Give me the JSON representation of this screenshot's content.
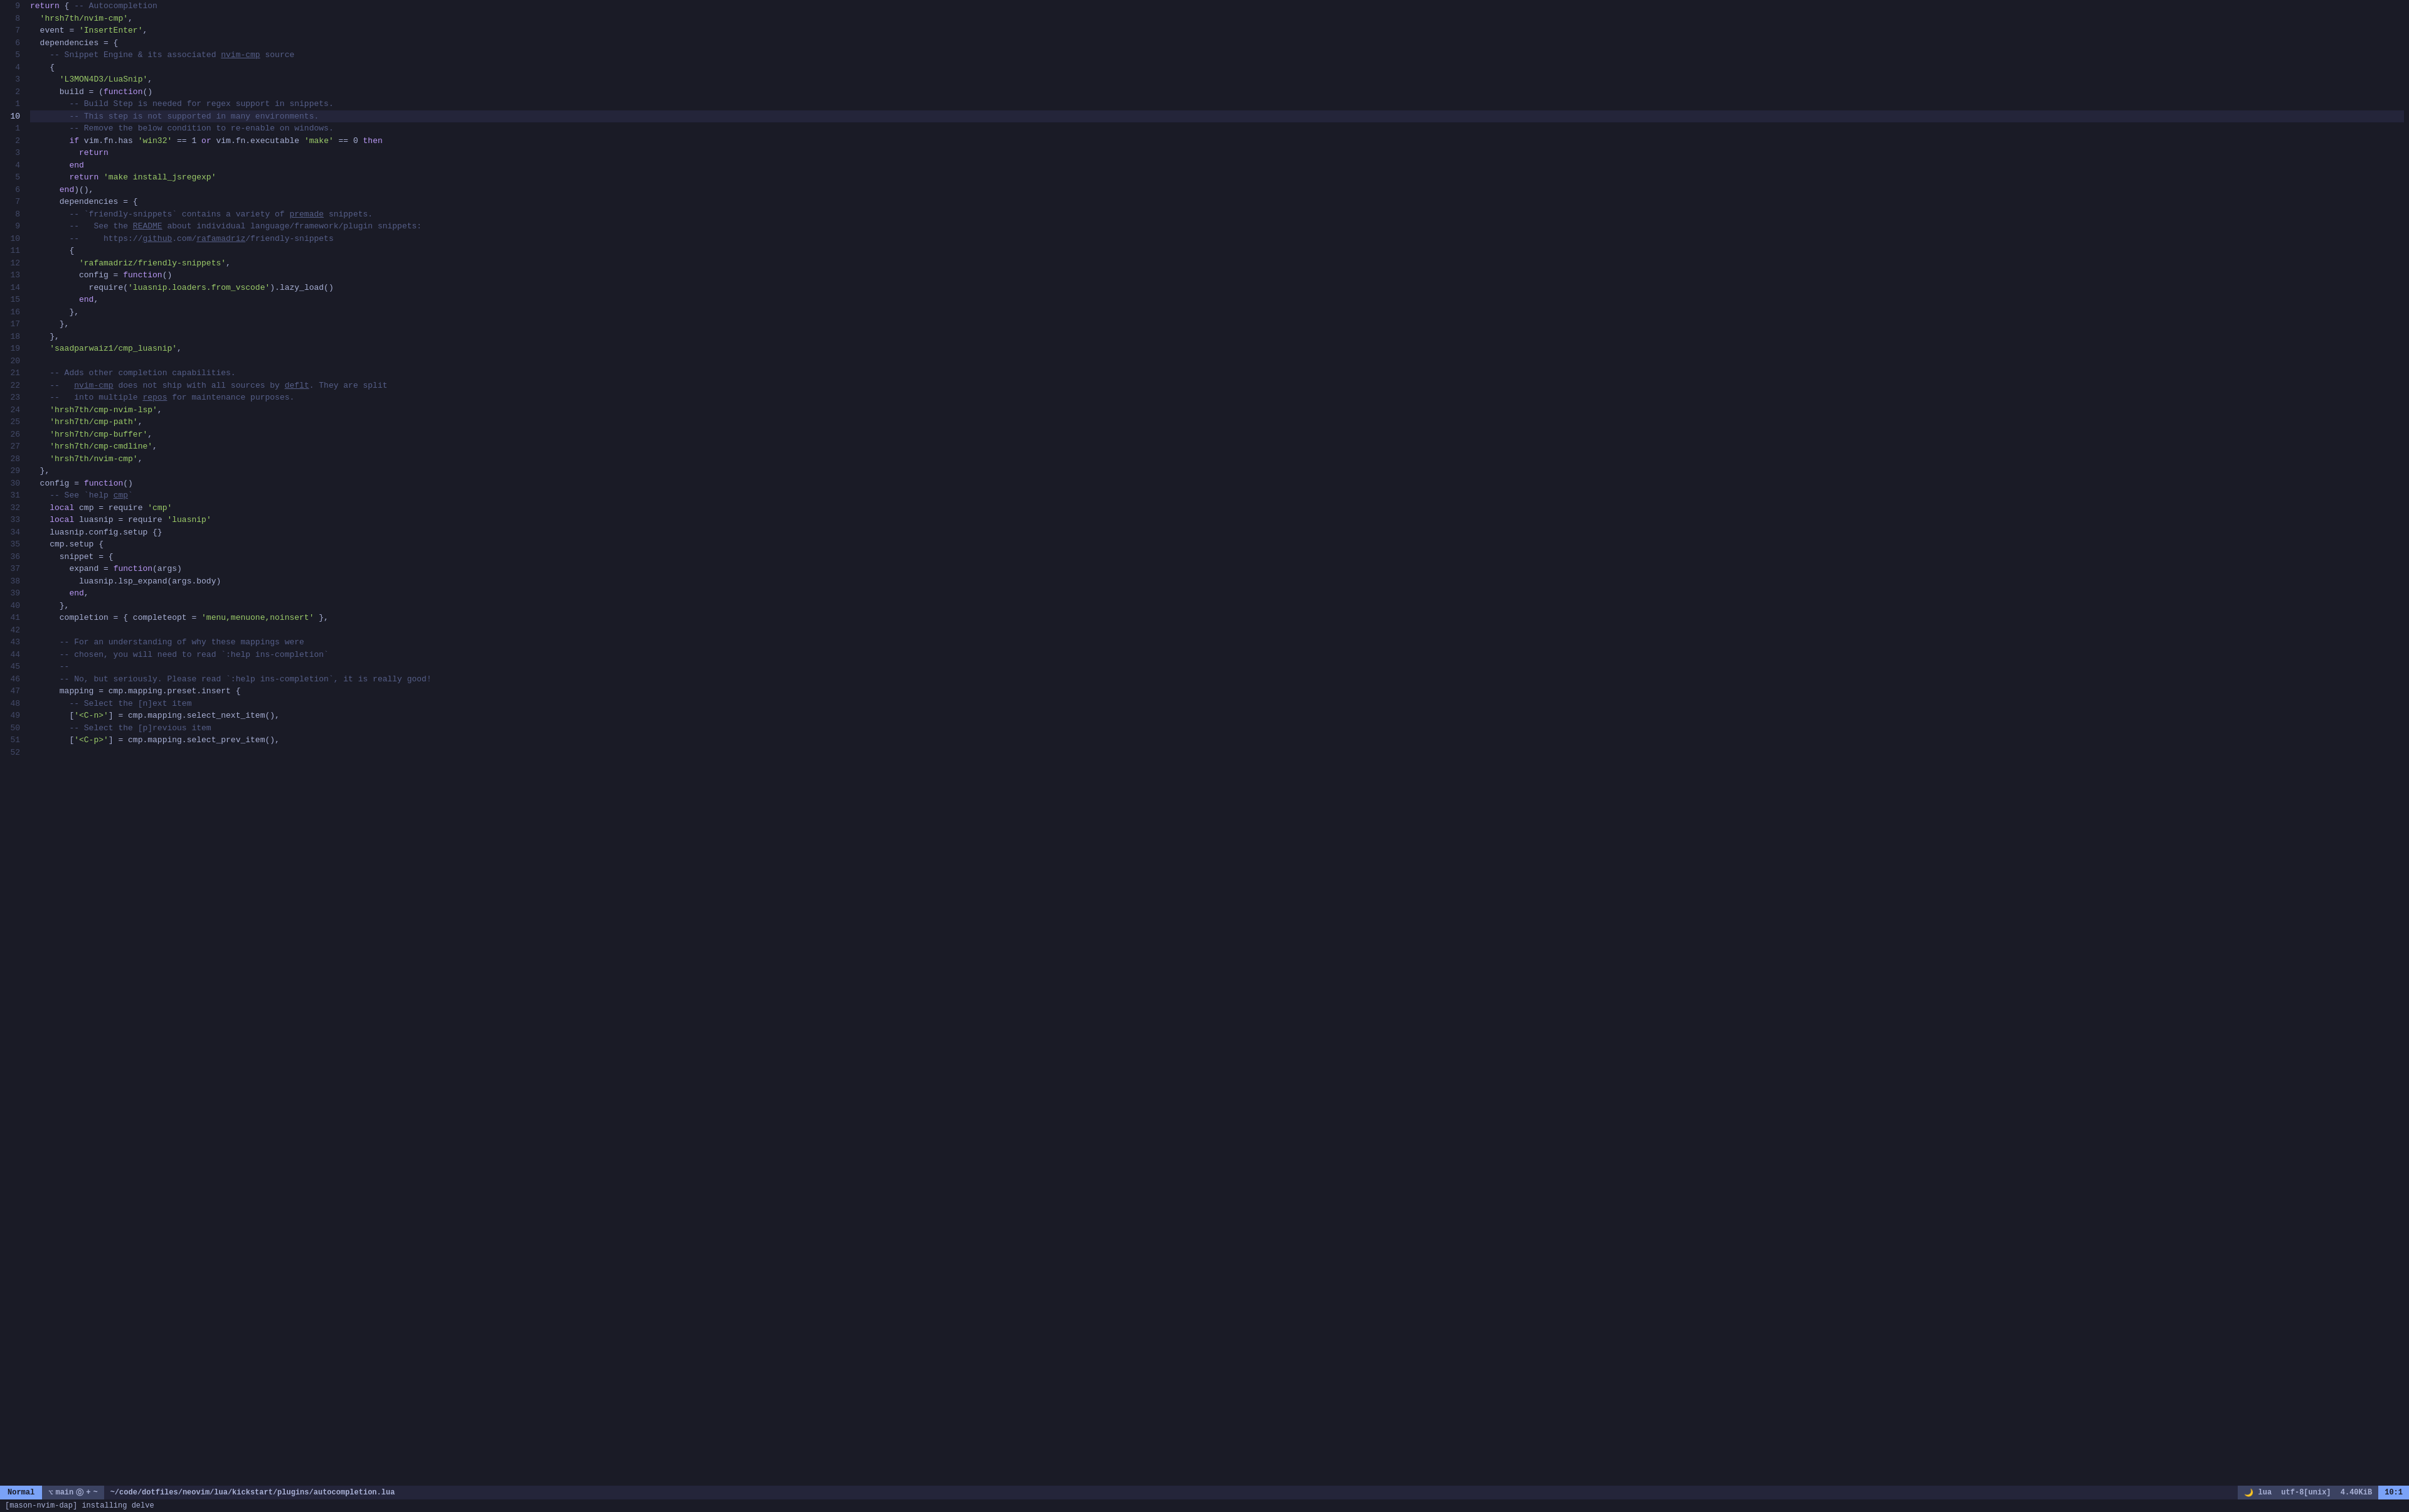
{
  "editor": {
    "lines": [
      {
        "num": 9,
        "content": "return { -- Autocompletion",
        "tokens": [
          {
            "t": "kw",
            "v": "return"
          },
          {
            "t": "plain",
            "v": " { "
          },
          {
            "t": "cmt",
            "v": "-- Autocompletion"
          }
        ]
      },
      {
        "num": 8,
        "content": "  'hrsh7th/nvim-cmp',",
        "tokens": [
          {
            "t": "plain",
            "v": "  "
          },
          {
            "t": "str",
            "v": "'hrsh7th/nvim-cmp'"
          },
          {
            "t": "plain",
            "v": ","
          }
        ]
      },
      {
        "num": 7,
        "content": "  event = 'InsertEnter',",
        "tokens": [
          {
            "t": "plain",
            "v": "  event = "
          },
          {
            "t": "str",
            "v": "'InsertEnter'"
          },
          {
            "t": "plain",
            "v": ","
          }
        ]
      },
      {
        "num": 6,
        "content": "  dependencies = {",
        "tokens": [
          {
            "t": "plain",
            "v": "  dependencies = {"
          }
        ]
      },
      {
        "num": 5,
        "content": "    -- Snippet Engine & its associated nvim-cmp source",
        "tokens": [
          {
            "t": "cmt",
            "v": "    -- Snippet Engine & its associated "
          },
          {
            "t": "cmt-link",
            "v": "nvim-cmp"
          },
          {
            "t": "cmt",
            "v": " source"
          }
        ]
      },
      {
        "num": 4,
        "content": "    {",
        "tokens": [
          {
            "t": "plain",
            "v": "    {"
          }
        ]
      },
      {
        "num": 3,
        "content": "      'L3MON4D3/LuaSnip',",
        "tokens": [
          {
            "t": "plain",
            "v": "      "
          },
          {
            "t": "str",
            "v": "'L3MON4D3/LuaSnip'"
          },
          {
            "t": "plain",
            "v": ","
          }
        ]
      },
      {
        "num": 2,
        "content": "      build = (function()",
        "tokens": [
          {
            "t": "plain",
            "v": "      build = ("
          },
          {
            "t": "kw",
            "v": "function"
          },
          {
            "t": "plain",
            "v": "()"
          }
        ]
      },
      {
        "num": 1,
        "content": "        -- Build Step is needed for regex support in snippets.",
        "tokens": [
          {
            "t": "cmt",
            "v": "        -- Build Step is needed for regex support in snippets."
          }
        ]
      },
      {
        "num": 10,
        "content": "        -- This step is not supported in many environments.",
        "tokens": [
          {
            "t": "cmt",
            "v": "        -- This step is not supported in many environments."
          }
        ],
        "current": true
      },
      {
        "num": 1,
        "content": "        -- Remove the below condition to re-enable on windows.",
        "tokens": [
          {
            "t": "cmt",
            "v": "        -- Remove the below condition to re-enable on windows."
          }
        ]
      },
      {
        "num": 2,
        "content": "        if vim.fn.has 'win32' == 1 or vim.fn.executable 'make' == 0 then",
        "tokens": [
          {
            "t": "plain",
            "v": "        "
          },
          {
            "t": "kw",
            "v": "if"
          },
          {
            "t": "plain",
            "v": " vim.fn.has "
          },
          {
            "t": "str",
            "v": "'win32'"
          },
          {
            "t": "plain",
            "v": " == 1 "
          },
          {
            "t": "kw",
            "v": "or"
          },
          {
            "t": "plain",
            "v": " vim.fn.executable "
          },
          {
            "t": "str",
            "v": "'make'"
          },
          {
            "t": "plain",
            "v": " == 0 "
          },
          {
            "t": "kw",
            "v": "then"
          }
        ]
      },
      {
        "num": 3,
        "content": "          return",
        "tokens": [
          {
            "t": "plain",
            "v": "          "
          },
          {
            "t": "kw",
            "v": "return"
          }
        ]
      },
      {
        "num": 4,
        "content": "        end",
        "tokens": [
          {
            "t": "plain",
            "v": "        "
          },
          {
            "t": "kw",
            "v": "end"
          }
        ]
      },
      {
        "num": 5,
        "content": "        return 'make install_jsregexp'",
        "tokens": [
          {
            "t": "plain",
            "v": "        "
          },
          {
            "t": "kw",
            "v": "return"
          },
          {
            "t": "plain",
            "v": " "
          },
          {
            "t": "str",
            "v": "'make install_jsregexp'"
          }
        ]
      },
      {
        "num": 6,
        "content": "      end)(),",
        "tokens": [
          {
            "t": "plain",
            "v": "      "
          },
          {
            "t": "kw",
            "v": "end"
          },
          {
            "t": "plain",
            "v": ")(),"
          }
        ]
      },
      {
        "num": 7,
        "content": "      dependencies = {",
        "tokens": [
          {
            "t": "plain",
            "v": "      dependencies = {"
          }
        ]
      },
      {
        "num": 8,
        "content": "        -- `friendly-snippets` contains a variety of premade snippets.",
        "tokens": [
          {
            "t": "cmt",
            "v": "        -- `friendly-snippets` contains a variety of "
          },
          {
            "t": "cmt-link",
            "v": "premade"
          },
          {
            "t": "cmt",
            "v": " snippets."
          }
        ]
      },
      {
        "num": 9,
        "content": "        --   See the README about individual language/framework/plugin snippets:",
        "tokens": [
          {
            "t": "cmt",
            "v": "        --   See the "
          },
          {
            "t": "cmt-link",
            "v": "README"
          },
          {
            "t": "cmt",
            "v": " about individual language/framework/plugin snippets:"
          }
        ]
      },
      {
        "num": 10,
        "content": "        --     https://github.com/rafamadriz/friendly-snippets",
        "tokens": [
          {
            "t": "cmt",
            "v": "        --     https://"
          },
          {
            "t": "cmt-link",
            "v": "github"
          },
          {
            "t": "cmt",
            "v": ".com/"
          },
          {
            "t": "cmt-link",
            "v": "rafamadriz"
          },
          {
            "t": "cmt",
            "v": "/friendly-snippets"
          }
        ]
      },
      {
        "num": 11,
        "content": "        {",
        "tokens": [
          {
            "t": "plain",
            "v": "        {"
          }
        ]
      },
      {
        "num": 12,
        "content": "          'rafamadriz/friendly-snippets',",
        "tokens": [
          {
            "t": "plain",
            "v": "          "
          },
          {
            "t": "str",
            "v": "'rafamadriz/friendly-snippets'"
          },
          {
            "t": "plain",
            "v": ","
          }
        ]
      },
      {
        "num": 13,
        "content": "          config = function()",
        "tokens": [
          {
            "t": "plain",
            "v": "          config = "
          },
          {
            "t": "kw",
            "v": "function"
          },
          {
            "t": "plain",
            "v": "()"
          }
        ]
      },
      {
        "num": 14,
        "content": "            require('luasnip.loaders.from_vscode').lazy_load()",
        "tokens": [
          {
            "t": "plain",
            "v": "            require("
          },
          {
            "t": "str",
            "v": "'luasnip.loaders.from_vscode'"
          },
          {
            "t": "plain",
            "v": ").lazy_load()"
          }
        ]
      },
      {
        "num": 15,
        "content": "          end,",
        "tokens": [
          {
            "t": "plain",
            "v": "          "
          },
          {
            "t": "kw",
            "v": "end"
          },
          {
            "t": "plain",
            "v": ","
          }
        ]
      },
      {
        "num": 16,
        "content": "        },",
        "tokens": [
          {
            "t": "plain",
            "v": "        },"
          }
        ]
      },
      {
        "num": 17,
        "content": "      },",
        "tokens": [
          {
            "t": "plain",
            "v": "      },"
          }
        ]
      },
      {
        "num": 18,
        "content": "    },",
        "tokens": [
          {
            "t": "plain",
            "v": "    },"
          }
        ]
      },
      {
        "num": 19,
        "content": "    'saadparwaiz1/cmp_luasnip',",
        "tokens": [
          {
            "t": "plain",
            "v": "    "
          },
          {
            "t": "str",
            "v": "'saadparwaiz1/cmp_luasnip'"
          },
          {
            "t": "plain",
            "v": ","
          }
        ]
      },
      {
        "num": 20,
        "content": "",
        "tokens": []
      },
      {
        "num": 21,
        "content": "    -- Adds other completion capabilities.",
        "tokens": [
          {
            "t": "cmt",
            "v": "    -- Adds other completion capabilities."
          }
        ]
      },
      {
        "num": 22,
        "content": "    --   nvim-cmp does not ship with all sources by deflt. They are split",
        "tokens": [
          {
            "t": "cmt",
            "v": "    --   "
          },
          {
            "t": "cmt-link",
            "v": "nvim-cmp"
          },
          {
            "t": "cmt",
            "v": " does not ship with all sources by "
          },
          {
            "t": "cmt-link",
            "v": "deflt"
          },
          {
            "t": "cmt",
            "v": ". They are split"
          }
        ]
      },
      {
        "num": 23,
        "content": "    --   into multiple repos for maintenance purposes.",
        "tokens": [
          {
            "t": "cmt",
            "v": "    --   into multiple "
          },
          {
            "t": "cmt-link",
            "v": "repos"
          },
          {
            "t": "cmt",
            "v": " for maintenance purposes."
          }
        ]
      },
      {
        "num": 24,
        "content": "    'hrsh7th/cmp-nvim-lsp',",
        "tokens": [
          {
            "t": "plain",
            "v": "    "
          },
          {
            "t": "str",
            "v": "'hrsh7th/cmp-nvim-lsp'"
          },
          {
            "t": "plain",
            "v": ","
          }
        ]
      },
      {
        "num": 25,
        "content": "    'hrsh7th/cmp-path',",
        "tokens": [
          {
            "t": "plain",
            "v": "    "
          },
          {
            "t": "str",
            "v": "'hrsh7th/cmp-path'"
          },
          {
            "t": "plain",
            "v": ","
          }
        ]
      },
      {
        "num": 26,
        "content": "    'hrsh7th/cmp-buffer',",
        "tokens": [
          {
            "t": "plain",
            "v": "    "
          },
          {
            "t": "str",
            "v": "'hrsh7th/cmp-buffer'"
          },
          {
            "t": "plain",
            "v": ","
          }
        ]
      },
      {
        "num": 27,
        "content": "    'hrsh7th/cmp-cmdline',",
        "tokens": [
          {
            "t": "plain",
            "v": "    "
          },
          {
            "t": "str",
            "v": "'hrsh7th/cmp-cmdline'"
          },
          {
            "t": "plain",
            "v": ","
          }
        ]
      },
      {
        "num": 28,
        "content": "    'hrsh7th/nvim-cmp',",
        "tokens": [
          {
            "t": "plain",
            "v": "    "
          },
          {
            "t": "str",
            "v": "'hrsh7th/nvim-cmp'"
          },
          {
            "t": "plain",
            "v": ","
          }
        ]
      },
      {
        "num": 29,
        "content": "  },",
        "tokens": [
          {
            "t": "plain",
            "v": "  },"
          }
        ]
      },
      {
        "num": 30,
        "content": "  config = function()",
        "tokens": [
          {
            "t": "plain",
            "v": "  config = "
          },
          {
            "t": "kw",
            "v": "function"
          },
          {
            "t": "plain",
            "v": "()"
          }
        ]
      },
      {
        "num": 31,
        "content": "    -- See `help cmp`",
        "tokens": [
          {
            "t": "cmt",
            "v": "    -- See "
          },
          {
            "t": "cmt",
            "v": "`help "
          },
          {
            "t": "cmt-link",
            "v": "cmp"
          },
          {
            "t": "cmt",
            "v": "`"
          }
        ]
      },
      {
        "num": 32,
        "content": "    local cmp = require 'cmp'",
        "tokens": [
          {
            "t": "plain",
            "v": "    "
          },
          {
            "t": "kw",
            "v": "local"
          },
          {
            "t": "plain",
            "v": " cmp = require "
          },
          {
            "t": "str",
            "v": "'cmp'"
          }
        ]
      },
      {
        "num": 33,
        "content": "    local luasnip = require 'luasnip'",
        "tokens": [
          {
            "t": "plain",
            "v": "    "
          },
          {
            "t": "kw",
            "v": "local"
          },
          {
            "t": "plain",
            "v": " luasnip = require "
          },
          {
            "t": "str",
            "v": "'luasnip'"
          }
        ]
      },
      {
        "num": 34,
        "content": "    luasnip.config.setup {}",
        "tokens": [
          {
            "t": "plain",
            "v": "    luasnip.config.setup {}"
          }
        ]
      },
      {
        "num": 35,
        "content": "    cmp.setup {",
        "tokens": [
          {
            "t": "plain",
            "v": "    cmp.setup {"
          }
        ]
      },
      {
        "num": 36,
        "content": "      snippet = {",
        "tokens": [
          {
            "t": "plain",
            "v": "      snippet = {"
          }
        ]
      },
      {
        "num": 37,
        "content": "        expand = function(args)",
        "tokens": [
          {
            "t": "plain",
            "v": "        expand = "
          },
          {
            "t": "kw",
            "v": "function"
          },
          {
            "t": "plain",
            "v": "(args)"
          }
        ]
      },
      {
        "num": 38,
        "content": "          luasnip.lsp_expand(args.body)",
        "tokens": [
          {
            "t": "plain",
            "v": "          luasnip.lsp_expand(args.body)"
          }
        ]
      },
      {
        "num": 39,
        "content": "        end,",
        "tokens": [
          {
            "t": "plain",
            "v": "        "
          },
          {
            "t": "kw",
            "v": "end"
          },
          {
            "t": "plain",
            "v": ","
          }
        ]
      },
      {
        "num": 40,
        "content": "      },",
        "tokens": [
          {
            "t": "plain",
            "v": "      },"
          }
        ]
      },
      {
        "num": 41,
        "content": "      completion = { completeopt = 'menu,menuone,noinsert' },",
        "tokens": [
          {
            "t": "plain",
            "v": "      completion = { completeopt = "
          },
          {
            "t": "str",
            "v": "'menu,menuone,noinsert'"
          },
          {
            "t": "plain",
            "v": " },"
          }
        ]
      },
      {
        "num": 42,
        "content": "",
        "tokens": []
      },
      {
        "num": 43,
        "content": "      -- For an understanding of why these mappings were",
        "tokens": [
          {
            "t": "cmt",
            "v": "      -- For an understanding of why these mappings were"
          }
        ]
      },
      {
        "num": 44,
        "content": "      -- chosen, you will need to read `:help ins-completion`",
        "tokens": [
          {
            "t": "cmt",
            "v": "      -- chosen, you will need to read `:help ins-completion`"
          }
        ]
      },
      {
        "num": 45,
        "content": "      --",
        "tokens": [
          {
            "t": "cmt",
            "v": "      --"
          }
        ]
      },
      {
        "num": 46,
        "content": "      -- No, but seriously. Please read `:help ins-completion`, it is really good!",
        "tokens": [
          {
            "t": "cmt",
            "v": "      -- No, but seriously. Please read `:help ins-completion`, it is really good!"
          }
        ]
      },
      {
        "num": 47,
        "content": "      mapping = cmp.mapping.preset.insert {",
        "tokens": [
          {
            "t": "plain",
            "v": "      mapping = cmp.mapping.preset.insert {"
          }
        ]
      },
      {
        "num": 48,
        "content": "        -- Select the [n]ext item",
        "tokens": [
          {
            "t": "cmt",
            "v": "        -- Select the [n]ext item"
          }
        ]
      },
      {
        "num": 49,
        "content": "        ['<C-n>'] = cmp.mapping.select_next_item(),",
        "tokens": [
          {
            "t": "plain",
            "v": "        ["
          },
          {
            "t": "str",
            "v": "'<C-n>'"
          },
          {
            "t": "plain",
            "v": "] = cmp.mapping.select_next_item(),"
          }
        ]
      },
      {
        "num": 50,
        "content": "        -- Select the [p]revious item",
        "tokens": [
          {
            "t": "cmt",
            "v": "        -- Select the [p]revious item"
          }
        ]
      },
      {
        "num": 51,
        "content": "        ['<C-p>'] = cmp.mapping.select_prev_item(),",
        "tokens": [
          {
            "t": "plain",
            "v": "        ["
          },
          {
            "t": "str",
            "v": "'<C-p>'"
          },
          {
            "t": "plain",
            "v": "] = cmp.mapping.select_prev_item(),"
          }
        ]
      },
      {
        "num": 52,
        "content": "",
        "tokens": []
      }
    ],
    "current_line": 10
  },
  "statusline": {
    "mode": "Normal",
    "git_icon": "⌥",
    "git_branch": "main",
    "git_diff": "⓪",
    "git_plus": "+",
    "git_tilde": "~",
    "filepath": "~/code/dotfiles/neovim/lua/kickstart/plugins/autocompletion.lua",
    "filetype": "lua",
    "encoding": "utf-8[unix]",
    "filesize": "4.40KiB",
    "position": "10:1",
    "percent": "10:1"
  },
  "bottom_message": "[mason-nvim-dap] installing delve"
}
